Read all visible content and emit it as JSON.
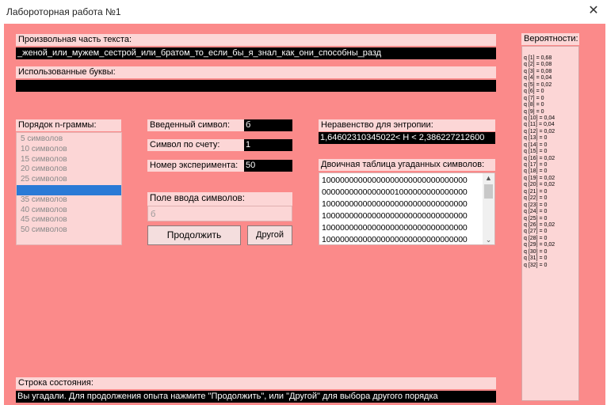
{
  "window": {
    "title": "Лабороторная работа №1"
  },
  "text_part": {
    "label": "Произвольная часть текста:",
    "value": "_женой_или_мужем_сестрой_или_братом_то_если_бы_я_знал_как_они_способны_разд"
  },
  "used_letters": {
    "label": "Использованные буквы:",
    "value": ""
  },
  "ngram": {
    "label": "Порядок n-граммы:",
    "options": [
      "5 символов",
      "10 символов",
      "15 символов",
      "20 символов",
      "25 символов",
      "30 символов",
      "35 символов",
      "40 символов",
      "45 символов",
      "50 символов"
    ],
    "selected_index": 5
  },
  "entered_symbol": {
    "label": "Введенный символ:",
    "value": "б"
  },
  "symbol_count": {
    "label": "Символ по счету:",
    "value": "1"
  },
  "experiment_no": {
    "label": "Номер эксперимента:",
    "value": "50"
  },
  "symbol_input": {
    "label": "Поле ввода символов:",
    "value": "б"
  },
  "buttons": {
    "continue": "Продолжить",
    "other": "Другой"
  },
  "entropy": {
    "label": "Неравенство для энтропии:",
    "value": "1,64602310345022< H < 2,386227212600"
  },
  "binary_table": {
    "label": "Двоичная таблица угаданных символов:",
    "rows": [
      "10000000000000000000000000000000",
      "00000000000000001000000000000000",
      "10000000000000000000000000000000",
      "10000000000000000000000000000000",
      "10000000000000000000000000000000",
      "10000000000000000000000000000000"
    ]
  },
  "status": {
    "label": "Строка состояния:",
    "value": "Вы угадали. Для продолжения опыта нажмите \"Продолжить\", или \"Другой\" для выбора другого порядка"
  },
  "probabilities": {
    "label": "Вероятности:",
    "items": [
      "q [1] = 0,68",
      "q [2] = 0,08",
      "q [3] = 0,08",
      "q [4] = 0,04",
      "q [5] = 0,02",
      "q [6] = 0",
      "q [7] = 0",
      "q [8] = 0",
      "q [9] = 0",
      "q [10] = 0,04",
      "q [11] = 0,04",
      "q [12] = 0,02",
      "q [13] = 0",
      "q [14] = 0",
      "q [15] = 0",
      "q [16] = 0,02",
      "q [17] = 0",
      "q [18] = 0",
      "q [19] = 0,02",
      "q [20] = 0,02",
      "q [21] = 0",
      "q [22] = 0",
      "q [23] = 0",
      "q [24] = 0",
      "q [25] = 0",
      "q [26] = 0,02",
      "q [27] = 0",
      "q [28] = 0",
      "q [29] = 0,02",
      "q [30] = 0",
      "q [31] = 0",
      "q [32] = 0"
    ]
  },
  "colors": {
    "background": "#fb8a8a",
    "label_bg": "#fcd6d6",
    "field_bg": "#000000",
    "selection": "#2a7ad6"
  }
}
